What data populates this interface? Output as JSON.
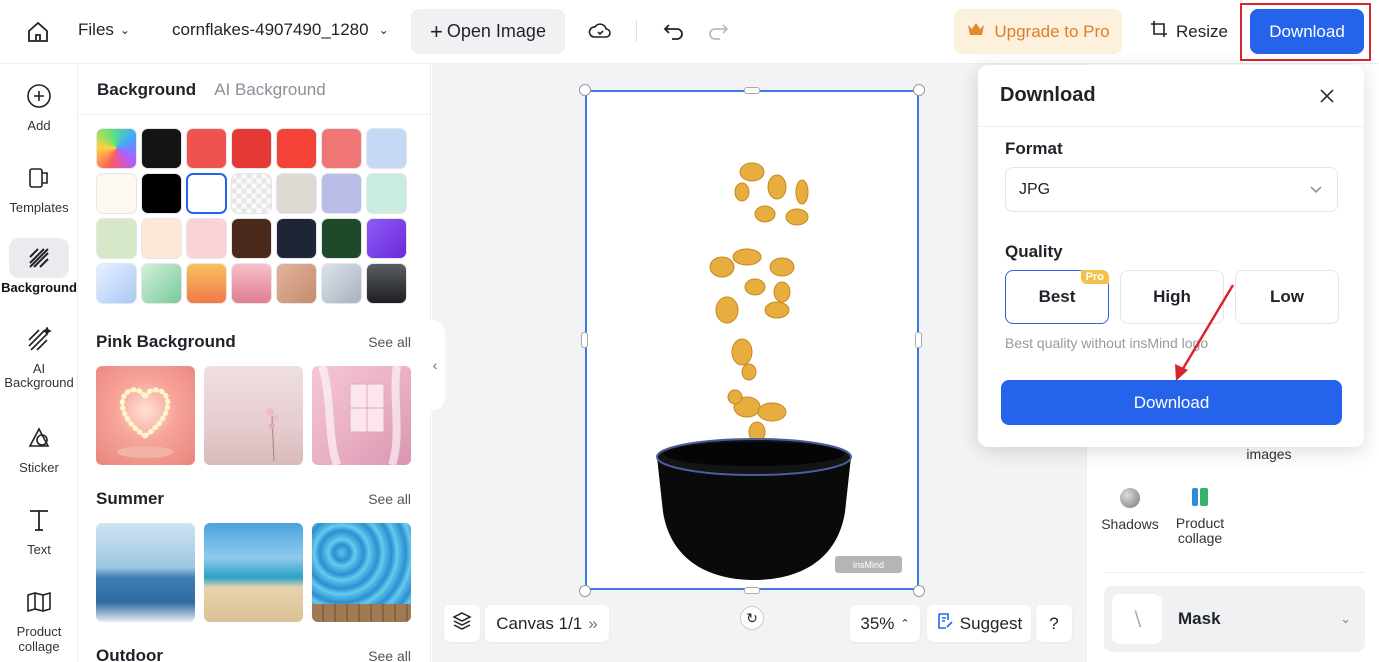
{
  "topbar": {
    "files_label": "Files",
    "file_name": "cornflakes-4907490_1280",
    "open_image": "Open Image",
    "upgrade": "Upgrade to Pro",
    "resize": "Resize",
    "download": "Download"
  },
  "rail": {
    "items": [
      {
        "label": "Add"
      },
      {
        "label": "Templates"
      },
      {
        "label": "Background"
      },
      {
        "label": "AI Background"
      },
      {
        "label": "Sticker"
      },
      {
        "label": "Text"
      },
      {
        "label": "Product collage"
      }
    ]
  },
  "panel": {
    "tab_background": "Background",
    "tab_ai": "AI Background",
    "swatch_colors": [
      "gradient-rainbow",
      "#151515",
      "#ef5350",
      "#e53935",
      "#f44336",
      "#f07676",
      "#c5d9f5",
      "#fdf8f2",
      "#000000",
      "#ffffff",
      "checker",
      "#dcdad3",
      "#b9bde8",
      "#c9ecdf",
      "#d7e8c9",
      "#fde7d6",
      "#fbd3d6",
      "#4a2a1a",
      "#1e2636",
      "#1f4a2a",
      "gradient-purple",
      "gradient-sky",
      "gradient-mint",
      "gradient-orange",
      "gradient-rose",
      "gradient-tan",
      "gradient-silver",
      "gradient-charcoal"
    ],
    "sections": [
      {
        "title": "Pink Background",
        "see_all": "See all"
      },
      {
        "title": "Summer",
        "see_all": "See all"
      },
      {
        "title": "Outdoor",
        "see_all": "See all"
      }
    ]
  },
  "canvas": {
    "watermark": "insMind",
    "canvas_label": "Canvas 1/1",
    "zoom": "35%",
    "suggest": "Suggest",
    "help": "?"
  },
  "right_panel": {
    "images_label": "images",
    "shadows": "Shadows",
    "product_collage": "Product collage",
    "mask": "Mask"
  },
  "download_popup": {
    "title": "Download",
    "format_label": "Format",
    "format_value": "JPG",
    "quality_label": "Quality",
    "quality_options": [
      "Best",
      "High",
      "Low"
    ],
    "selected_quality": "Best",
    "pro_badge": "Pro",
    "note": "Best quality without insMind logo",
    "download_button": "Download"
  },
  "colors": {
    "accent": "#2563eb",
    "upgrade_bg": "#fdf0dd",
    "upgrade_text": "#d9812a",
    "highlight": "#d7262d"
  }
}
